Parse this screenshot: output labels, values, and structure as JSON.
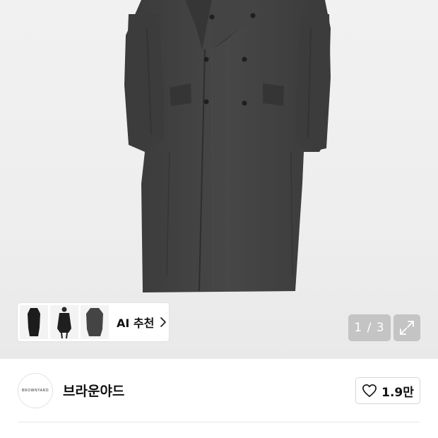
{
  "gallery": {
    "pager_current": "1",
    "pager_total": "3",
    "pager_text": "1 / 3",
    "ai_recommend_label": "AI 추천",
    "icons": {
      "expand": "expand-icon",
      "chevron": "chevron-right-icon"
    }
  },
  "brand": {
    "logo_text": "BROWNYARD",
    "name": "브라운야드",
    "like_count": "1.9만",
    "like_icon": "heart-icon"
  },
  "colors": {
    "coat": "#3f3f3f",
    "background": "#eeeeee",
    "pager_bg": "#9a9a9a"
  }
}
